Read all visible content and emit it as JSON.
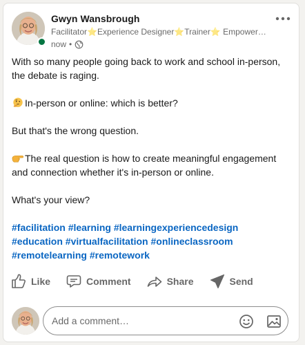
{
  "post": {
    "author": {
      "name": "Gwyn Wansbrough",
      "headline": "Facilitator⭐Experience Designer⭐Trainer⭐ Empowering people to design and run engaging experiences",
      "timestamp": "now",
      "separator": "•",
      "online": true
    },
    "more_label": "•••",
    "body": {
      "line1": "With so many people going back to work and school in-person, the debate is raging.",
      "line2": "In-person or online: which is better?",
      "line3": "But that's the wrong question.",
      "line4": "The real question is how to create meaningful engagement and connection whether it's in-person or online.",
      "line5": "What's your view?"
    },
    "hashtags": [
      "#facilitation",
      "#learning",
      "#learningexperiencedesign",
      "#education",
      "#virtualfacilitation",
      "#onlineclassroom",
      "#remotelearning",
      "#remotework"
    ]
  },
  "actions": {
    "like": "Like",
    "comment": "Comment",
    "share": "Share",
    "send": "Send"
  },
  "comment_box": {
    "placeholder": "Add a comment…"
  },
  "icons": {
    "thinking": "thinking-face-emoji-icon",
    "pointing": "pointing-hand-emoji-icon",
    "globe": "globe-icon",
    "like": "thumbs-up-icon",
    "comment": "speech-bubble-icon",
    "share": "share-arrow-icon",
    "send": "paper-plane-icon",
    "emoji": "smiley-icon",
    "image": "image-icon"
  },
  "colors": {
    "link": "#0a66c2",
    "presence": "#057642",
    "muted": "#666666"
  }
}
